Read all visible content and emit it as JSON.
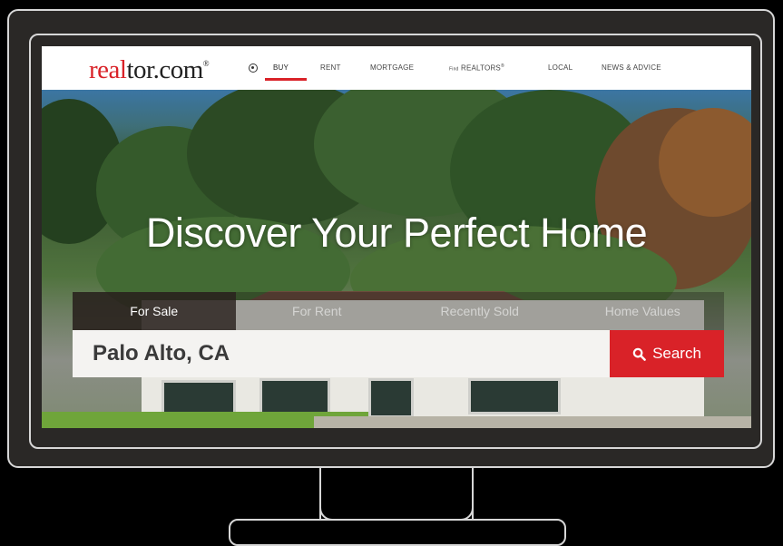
{
  "brand": {
    "logo_red": "real",
    "logo_rest": "tor.com",
    "logo_mark": "®",
    "accent": "#d92228"
  },
  "nav": {
    "items": [
      {
        "label": "BUY",
        "active": true
      },
      {
        "label": "RENT"
      },
      {
        "label": "MORTGAGE"
      },
      {
        "label_prefix": "Find",
        "label": "REALTORS",
        "sup": "®"
      },
      {
        "label": "LOCAL"
      },
      {
        "label": "NEWS & ADVICE"
      }
    ]
  },
  "hero": {
    "headline": "Discover Your Perfect Home"
  },
  "search": {
    "tabs": [
      {
        "label": "For Sale",
        "active": true
      },
      {
        "label": "For Rent"
      },
      {
        "label": "Recently Sold"
      },
      {
        "label": "Home Values"
      }
    ],
    "value": "Palo Alto, CA",
    "button_label": "Search",
    "button_icon": "search-icon"
  }
}
